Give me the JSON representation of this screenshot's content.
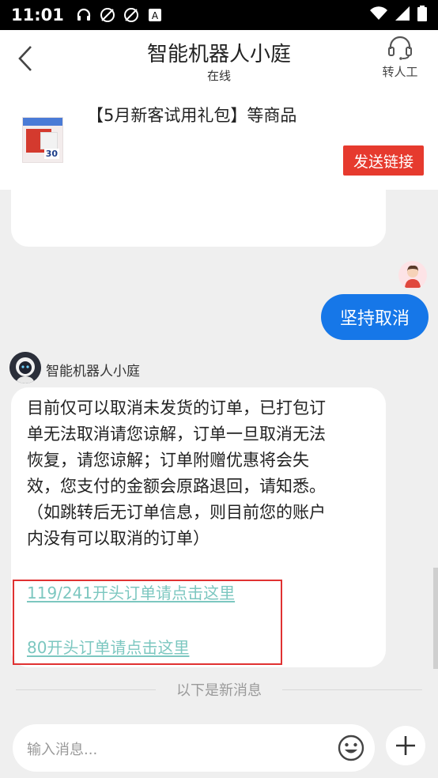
{
  "status_bar": {
    "time": "11:01",
    "left_icons": [
      "headphone-icon",
      "sync-off-icon",
      "sync-off-icon",
      "keyboard-a-icon"
    ],
    "right_icons": [
      "wifi-icon",
      "signal-icon",
      "battery-icon"
    ]
  },
  "header": {
    "title": "智能机器人小庭",
    "subtitle": "在线",
    "human_label": "转人工"
  },
  "product": {
    "name": "【5月新客试用礼包】等商品",
    "thumb_number": "30",
    "send_button": "发送链接"
  },
  "user_message": {
    "text": "坚持取消"
  },
  "bot": {
    "name": "智能机器人小庭",
    "lines": [
      "目前仅可以取消未发货的订单，已打包订",
      "单无法取消请您谅解，订单一旦取消无法",
      "恢复，请您谅解；订单附赠优惠将会失",
      "效，您支付的金额会原路退回，请知悉。",
      "（如跳转后无订单信息，则目前您的账户",
      "内没有可以取消的订单）"
    ],
    "link1": "119/241开头订单请点击这里",
    "link2": "80开头订单请点击这里"
  },
  "divider": {
    "text": "以下是新消息"
  },
  "input": {
    "placeholder": "输入消息..."
  },
  "colors": {
    "accent_blue": "#1677e8",
    "send_red": "#e63a2e",
    "link_teal": "#7cc7c0",
    "highlight_red": "#e03232"
  }
}
